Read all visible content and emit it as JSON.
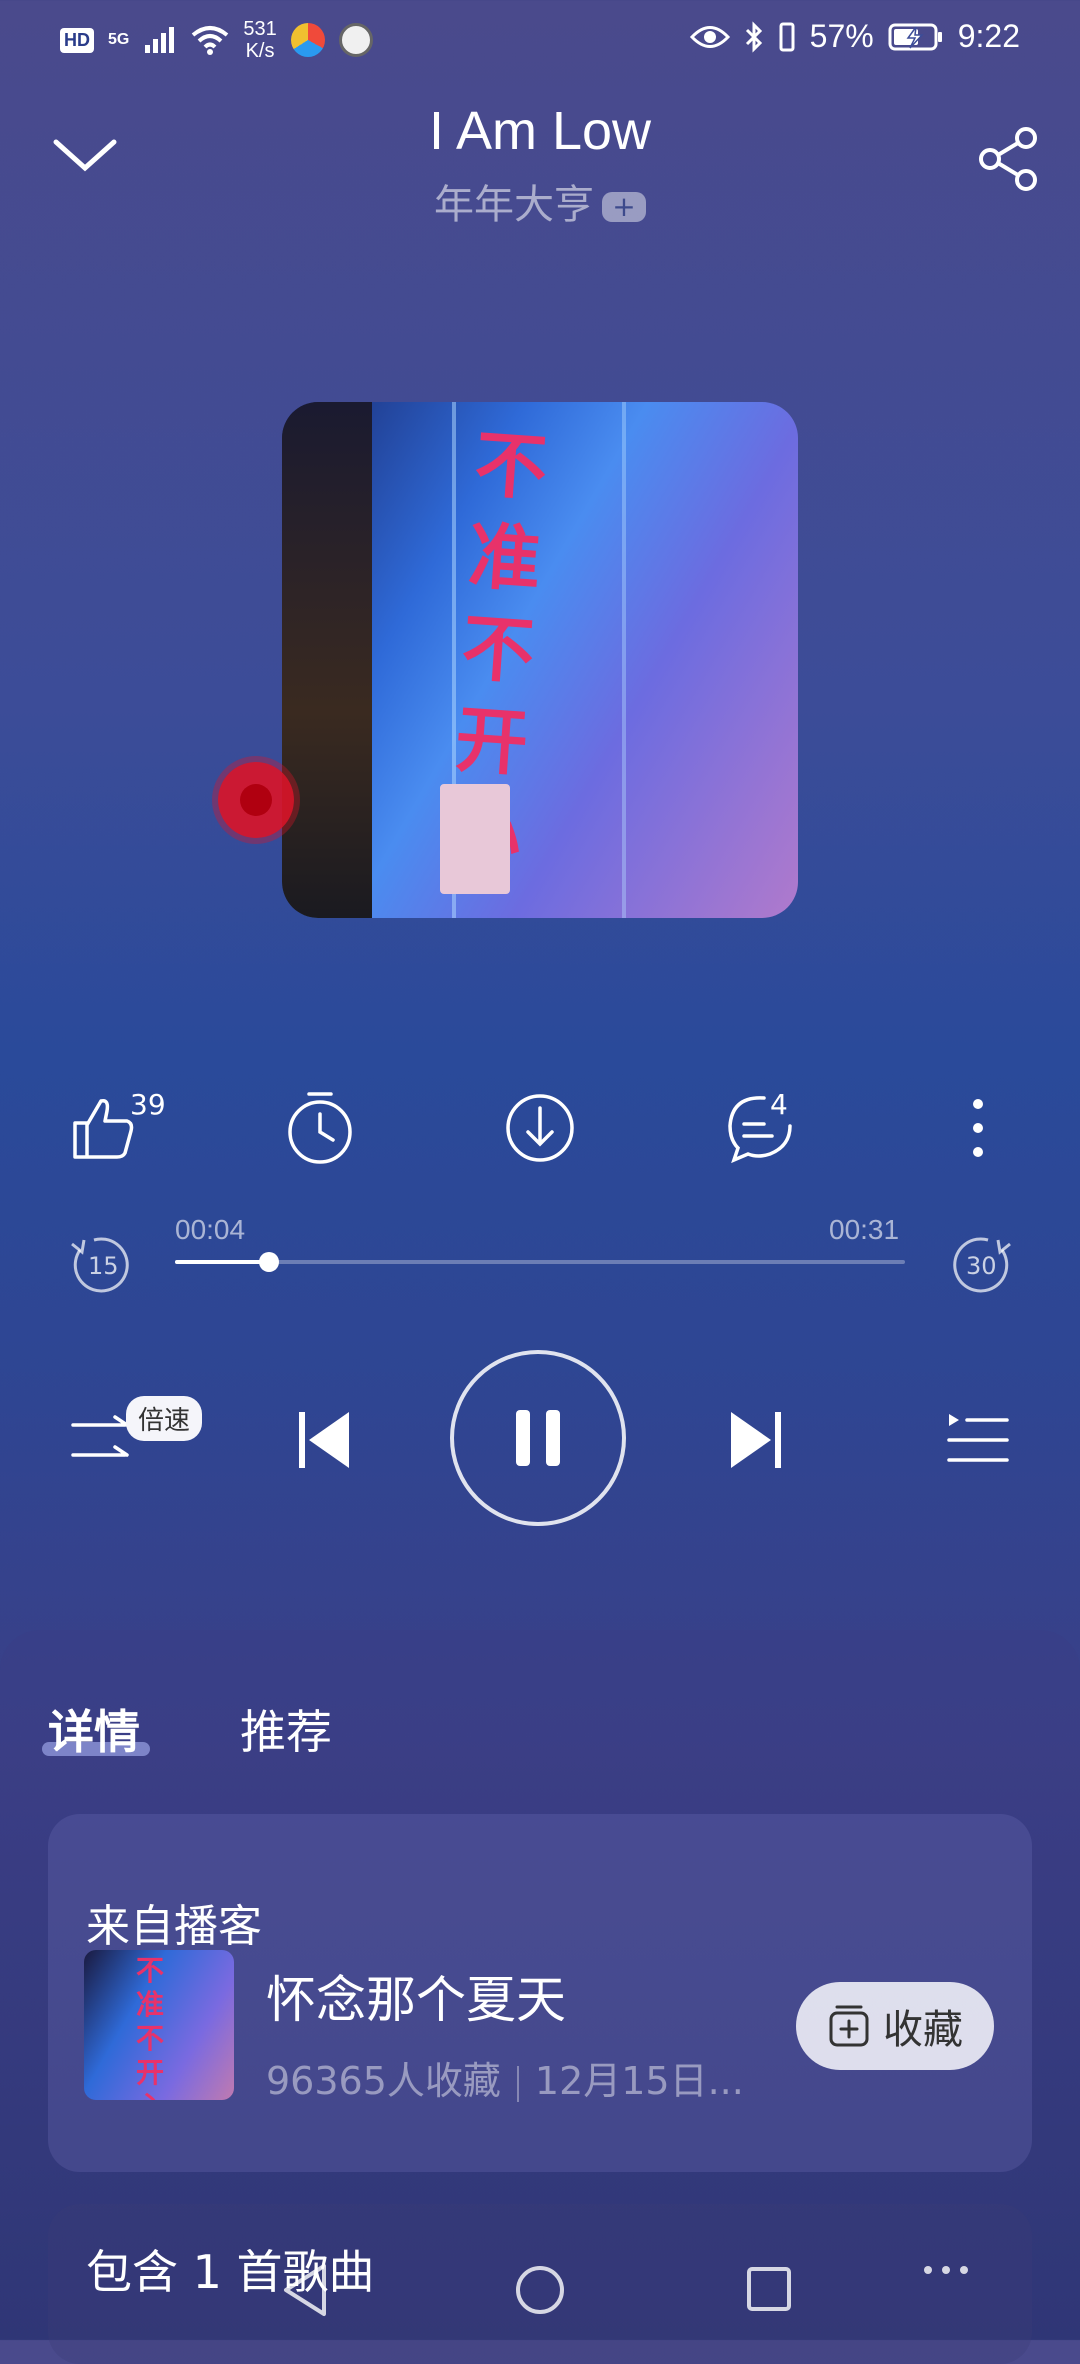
{
  "status_bar": {
    "hd": "HD",
    "network": "5G",
    "speed_value": "531",
    "speed_unit": "K/s",
    "battery": "57%",
    "time": "9:22"
  },
  "header": {
    "title": "I Am Low",
    "artist": "年年大亨",
    "follow_badge": "+"
  },
  "cover": {
    "sign_text": "不准不开心"
  },
  "actions": {
    "like_count": "39",
    "comment_count": "4"
  },
  "progress": {
    "current": "00:04",
    "total": "00:31",
    "fraction": 0.129,
    "rewind_seconds": "15",
    "forward_seconds": "30"
  },
  "controls": {
    "speed_label": "倍速"
  },
  "tabs": [
    {
      "label": "详情"
    },
    {
      "label": "推荐"
    }
  ],
  "podcast_card": {
    "heading": "来自播客",
    "name": "怀念那个夏天",
    "subscribers": "96365人收藏",
    "date": "12月15日...",
    "collect_label": "收藏"
  },
  "songs_card": {
    "heading": "包含 1 首歌曲"
  },
  "colors": {
    "accent_red": "#e8326a",
    "background_top": "#4a4a8c",
    "background_mid": "#2a4a9a"
  }
}
